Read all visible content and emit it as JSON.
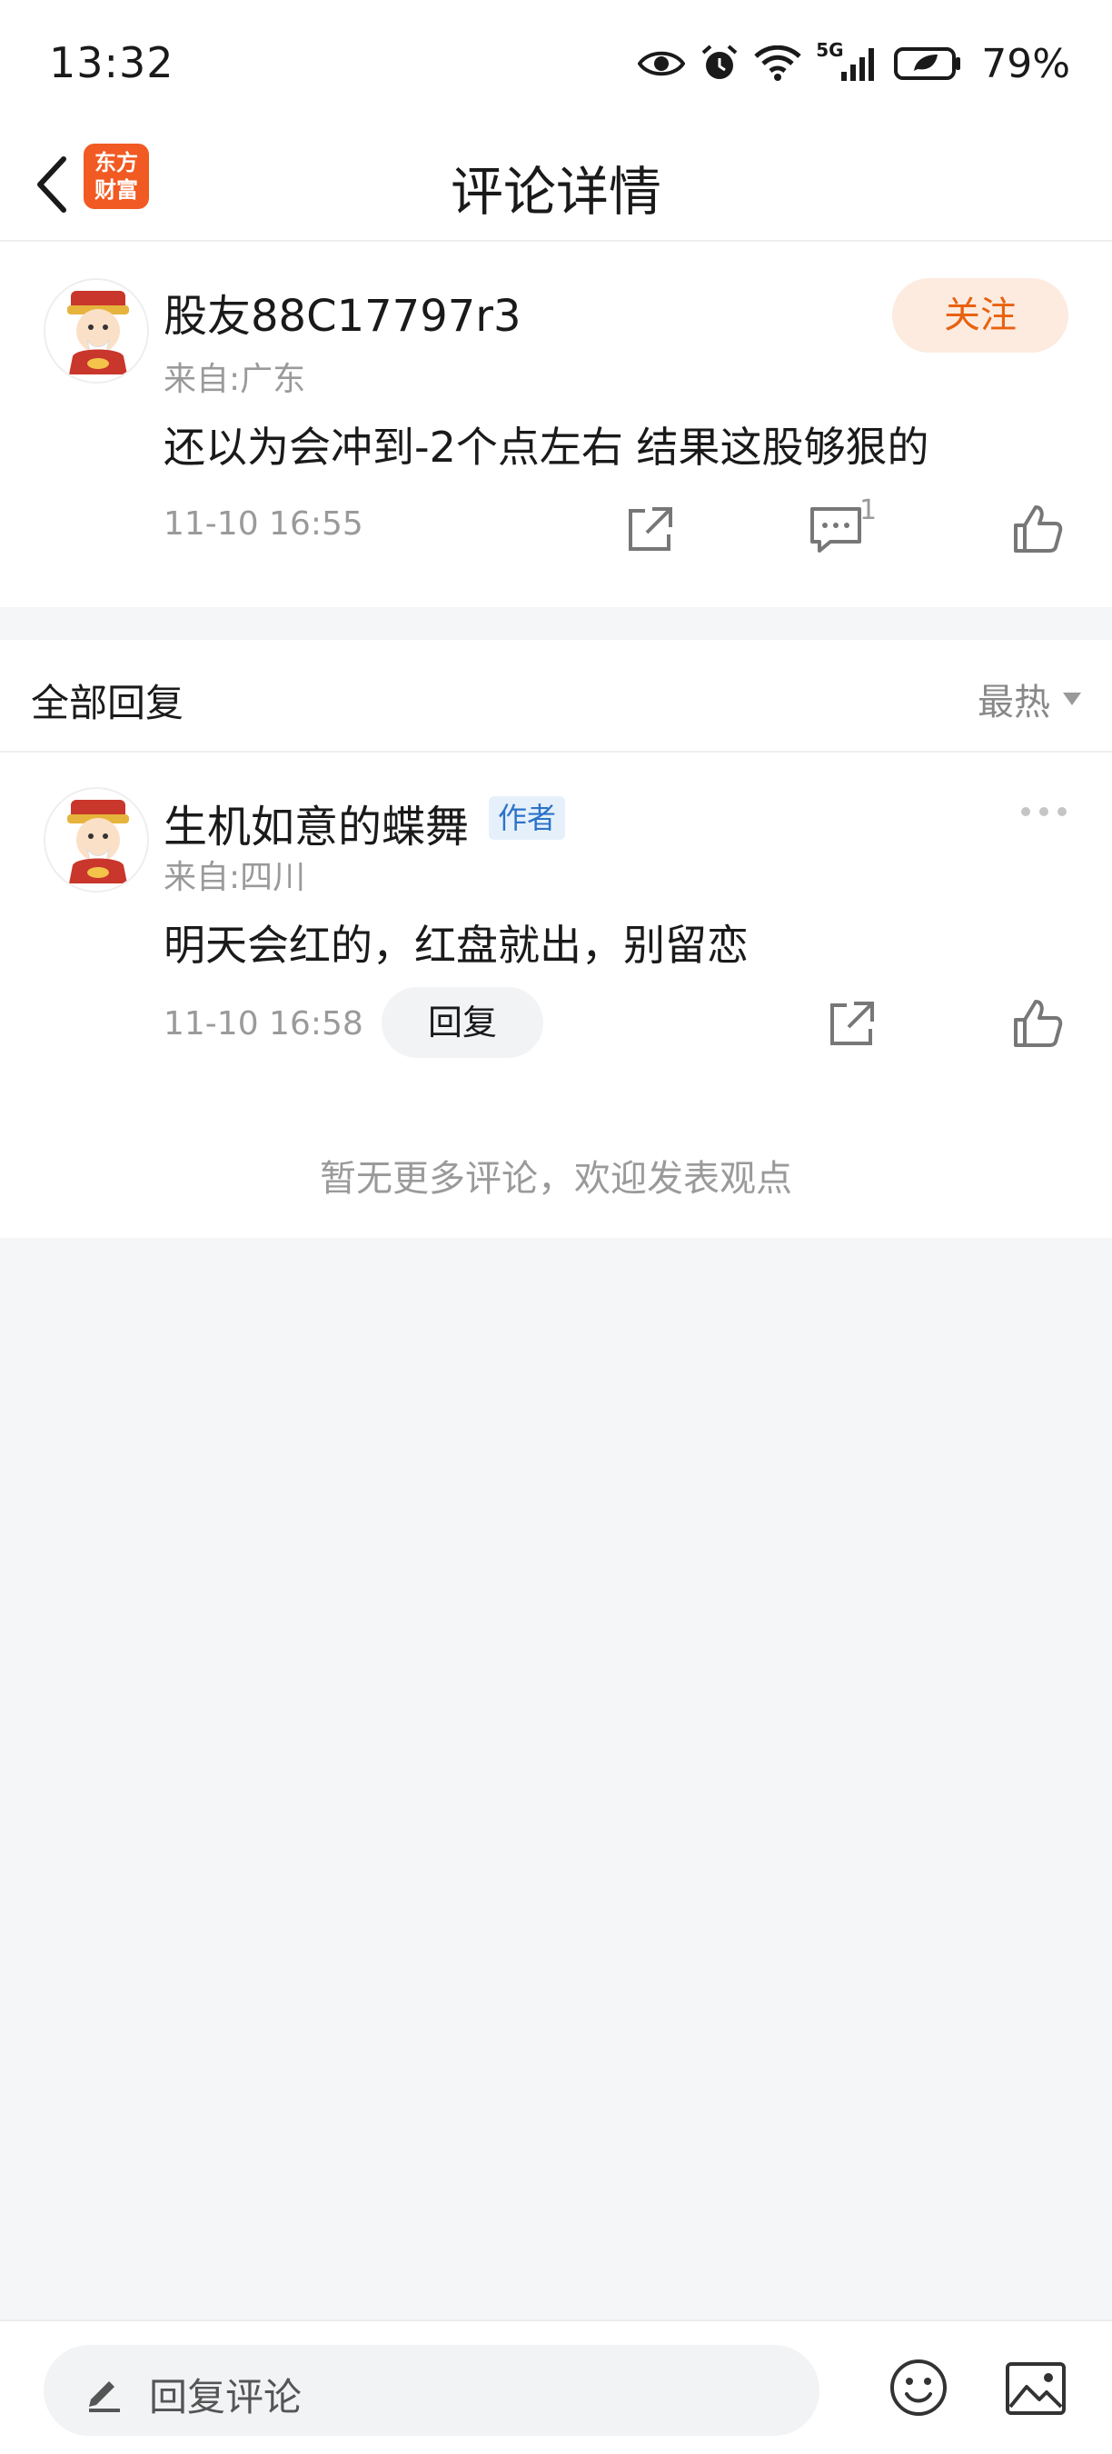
{
  "status_bar": {
    "time": "13:32",
    "network": "5G",
    "battery": "79%"
  },
  "header": {
    "back_icon": "chevron-left-icon",
    "logo_line1": "东方",
    "logo_line2": "财富",
    "title": "评论详情"
  },
  "main_comment": {
    "username": "股友88C17797r3",
    "follow_label": "关注",
    "location": "来自:广东",
    "text": "还以为会冲到-2个点左右 结果这股够狠的",
    "timestamp": "11-10 16:55",
    "reply_count": "1"
  },
  "replies_section": {
    "label": "全部回复",
    "sort_label": "最热"
  },
  "reply": {
    "username": "生机如意的蝶舞",
    "author_badge": "作者",
    "location": "来自:四川",
    "text": "明天会红的，红盘就出，别留恋",
    "timestamp": "11-10 16:58",
    "reply_label": "回复"
  },
  "no_more_text": "暂无更多评论，欢迎发表观点",
  "bottom_bar": {
    "placeholder": "回复评论"
  },
  "colors": {
    "accent": "#e8620f",
    "logo": "#f15a22",
    "badge": "#2b73c9"
  }
}
